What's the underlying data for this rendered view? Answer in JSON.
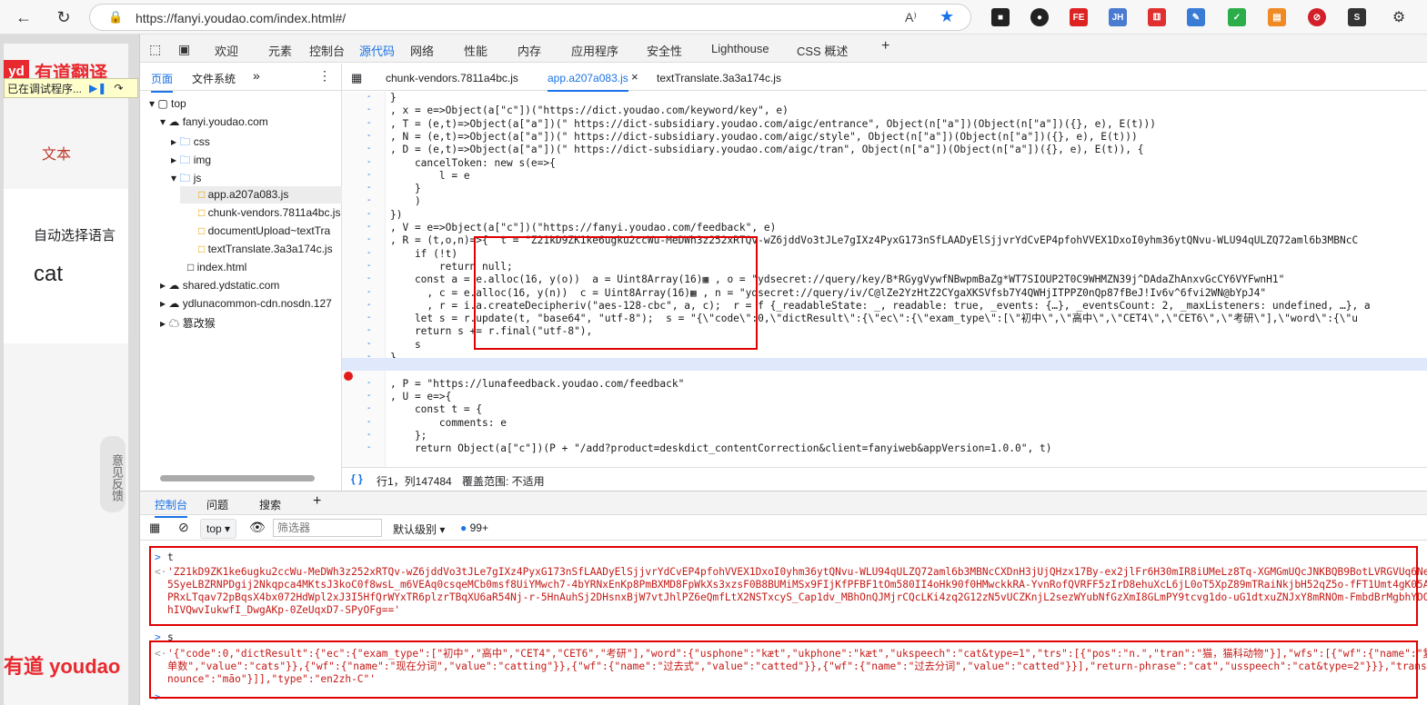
{
  "browser": {
    "url": "https://fanyi.youdao.com/index.html#/",
    "read_aloud": "A⁾"
  },
  "extensions": [
    "FE",
    "JH"
  ],
  "page": {
    "debug_label": "已在调试程序...",
    "logo_cn": "有道翻译",
    "text_tab": "文本",
    "auto_lang": "自动选择语言",
    "input_word": "cat",
    "feedback": "意见反馈",
    "footer_logo": "有道 youdao"
  },
  "devtools": {
    "tabs": [
      "欢迎",
      "元素",
      "控制台",
      "源代码",
      "网络",
      "性能",
      "内存",
      "应用程序",
      "安全性",
      "Lighthouse",
      "CSS 概述"
    ],
    "nav_tabs": [
      "页面",
      "文件系统"
    ],
    "tree": [
      "top",
      "fanyi.youdao.com",
      "css",
      "img",
      "js",
      "app.a207a083.js",
      "chunk-vendors.7811a4bc.js",
      "documentUpload~textTra",
      "textTranslate.3a3a174c.js",
      "index.html",
      "shared.ydstatic.com",
      "ydlunacommon-cdn.nosdn.127",
      "篡改猴"
    ],
    "editor_tabs": [
      "chunk-vendors.7811a4bc.js",
      "app.a207a083.js",
      "textTranslate.3a3a174c.js"
    ],
    "code": [
      "}",
      ", x = e=>Object(a[\"c\"])(\"https://dict.youdao.com/keyword/key\", e)",
      ", T = (e,t)=>Object(a[\"a\"])(\" https://dict-subsidiary.youdao.com/aigc/entrance\", Object(n[\"a\"])(Object(n[\"a\"])({}, e), E(t)))",
      ", N = (e,t)=>Object(a[\"a\"])(\" https://dict-subsidiary.youdao.com/aigc/style\", Object(n[\"a\"])(Object(n[\"a\"])({}, e), E(t)))",
      ", D = (e,t)=>Object(a[\"a\"])(\" https://dict-subsidiary.youdao.com/aigc/tran\", Object(n[\"a\"])(Object(n[\"a\"])({}, e), E(t)), {",
      "    cancelToken: new s(e=>{",
      "        l = e",
      "    }",
      "    )",
      "})",
      ", V = e=>Object(a[\"c\"])(\"https://fanyi.youdao.com/feedback\", e)",
      ", R = (t,o,n)=>{  t = \"Z21kD9ZK1ke6ugku2ccWu-MeDWh3z252xRTQv-wZ6jddVo3tJLe7gIXz4PyxG173nSfLAADyElSjjvrYdCvEP4pfohVVEX1DxoI0yhm36ytQNvu-WLU94qULZQ72aml6b3MBNcC",
      "    if (!t)",
      "        return null;",
      "    const a = e.alloc(16, y(o))  a = Uint8Array(16)▦ , o = \"ydsecret://query/key/B*RGygVywfNBwpmBaZg*WT7SIOUP2T0C9WHMZN39j^DAdaZhAnxvGcCY6VYFwnH1\"",
      "      , c = e.alloc(16, y(n))  c = Uint8Array(16)▦ , n = \"ydsecret://query/iv/C@lZe2YzHtZ2CYgaXKSVfsb7Y4QWHjITPPZ0nQp87fBeJ!Iv6v^6fvi2WN@bYpJ4\"",
      "      , r = i.a.createDecipheriv(\"aes-128-cbc\", a, c);  r = f {_readableState: _, readable: true, _events: {…}, _eventsCount: 2, _maxListeners: undefined, …}, a",
      "    let s = r.update(t, \"base64\", \"utf-8\");  s = \"{\\\"code\\\":0,\\\"dictResult\\\":{\\\"ec\\\":{\\\"exam_type\\\":[\\\"初中\\\",\\\"高中\\\",\\\"CET4\\\",\\\"CET6\\\",\\\"考研\\\"],\\\"word\\\":{\\\"u",
      "    return s += r.final(\"utf-8\"),",
      "    s",
      "}",
      "",
      ", P = \"https://lunafeedback.youdao.com/feedback\"",
      ", U = e=>{",
      "    const t = {",
      "        comments: e",
      "    };",
      "    return Object(a[\"c\"])(P + \"/add?product=deskdict_contentCorrection&client=fanyiweb&appVersion=1.0.0\", t)"
    ],
    "status": {
      "position": "行1，列147484",
      "coverage": "覆盖范围: 不适用"
    },
    "console_tabs": [
      "控制台",
      "问题",
      "搜索"
    ],
    "console_toolbar": {
      "context": "top",
      "filter_placeholder": "筛选器",
      "level": "默认级别",
      "issues": "99+"
    },
    "console": {
      "cmd_t": "t",
      "out_t": [
        "'Z21kD9ZK1ke6ugku2ccWu-MeDWh3z252xRTQv-wZ6jddVo3tJLe7gIXz4PyxG173nSfLAADyElSjjvrYdCvEP4pfohVVEX1DxoI0yhm36ytQNvu-WLU94qULZQ72aml6b3MBNcCXDnH3jUjQHzx17By-ex2jlFr6H30mIR8iUMeLz8Tq-XGMGmUQcJNKBQB9BotLVRGVUq6NeYsHcW",
        "5SyeLBZRNPDgij2Nkqpca4MKtsJ3koC0f8wsL_m6VEAq0csqeMCb0msf8UiYMwch7-4bYRNxEnKp8PmBXMD8FpWkXs3xzsF0B8BUMiMSx9FIjKfPFBF1tOm580II4oHk90f0HMwckkRA-YvnRofQVRFF5zIrD8ehuXcL6jL0oT5XpZ89mTRaiNkjbH52qZ5o-fFT1Umt4gK05AXY6sA",
        "PRxLTqav72pBqsX4bx072HdWpl2xJ3I5HfQrWYxTR6plzrTBqXU6aR54Nj-r-5HnAuhSj2DHsnxBjW7vtJhlPZ6eQmfLtX2NSTxcyS_Cap1dv_MBhOnQJMjrCQcLKi4zq2G12zN5vUCZKnjL2sezWYubNfGzXmI8GLmPY9tcvg1do-uG1dtxuZNJxY8mRNOm-FmbdBrMgbhYDOoX1b",
        "hIVQwvIukwfI_DwgAKp-0ZeUqxD7-SPyOFg=='"
      ],
      "cmd_s": "s",
      "out_s": [
        "'{\"code\":0,\"dictResult\":{\"ec\":{\"exam_type\":[\"初中\",\"高中\",\"CET4\",\"CET6\",\"考研\"],\"word\":{\"usphone\":\"kæt\",\"ukphone\":\"kæt\",\"ukspeech\":\"cat&type=1\",\"trs\":[{\"pos\":\"n.\",\"tran\":\"猫，猫科动物\"}],\"wfs\":[{\"wf\":{\"name\":\"复数\",",
        "单数\",\"value\":\"cats\"}},{\"wf\":{\"name\":\"现在分词\",\"value\":\"catting\"}},{\"wf\":{\"name\":\"过去式\",\"value\":\"catted\"}},{\"wf\":{\"name\":\"过去分词\",\"value\":\"catted\"}}],\"return-phrase\":\"cat\",\"usspeech\":\"cat&type=2\"}}},\"translat",
        "nounce\":\"māo\"}]],\"type\":\"en2zh-C\"'"
      ]
    }
  },
  "colors": {
    "accent": "#1a73e8",
    "red_box": "#e00000",
    "youdao_red": "#e8292f"
  }
}
